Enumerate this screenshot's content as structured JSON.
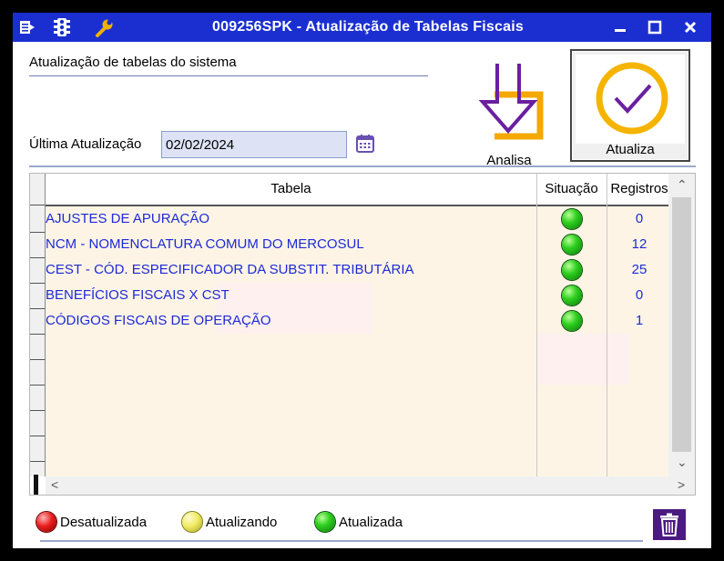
{
  "window": {
    "title": "009256SPK - Atualização de Tabelas Fiscais",
    "titlebar_color": "#1b2fd1",
    "icons": [
      "export-icon",
      "traffic-light-icon",
      "wrench-icon"
    ],
    "controls": [
      "minimize-icon",
      "maximize-icon",
      "close-icon"
    ]
  },
  "header": {
    "section_label": "Atualização de tabelas do sistema",
    "last_update_label": "Última Atualização",
    "last_update_value": "02/02/2024",
    "analisa_label": "Analisa",
    "atualiza_label": "Atualiza"
  },
  "grid": {
    "columns": [
      "Tabela",
      "Situação",
      "Registros"
    ],
    "rows": [
      {
        "tabela": "AJUSTES DE APURAÇÃO",
        "situacao": "green",
        "registros": "0"
      },
      {
        "tabela": "NCM - NOMENCLATURA COMUM DO MERCOSUL",
        "situacao": "green",
        "registros": "12"
      },
      {
        "tabela": "CEST - CÓD. ESPECIFICADOR DA SUBSTIT. TRIBUTÁRIA",
        "situacao": "green",
        "registros": "25"
      },
      {
        "tabela": "BENEFÍCIOS FISCAIS X CST",
        "situacao": "green",
        "registros": "0"
      },
      {
        "tabela": "CÓDIGOS FISCAIS DE OPERAÇÃO",
        "situacao": "green",
        "registros": "1"
      }
    ],
    "text_color": "#1d2ad6",
    "row_background": "#fdf4e6"
  },
  "legend": {
    "desatualizada": "Desatualizada",
    "atualizando": "Atualizando",
    "atualizada": "Atualizada"
  }
}
